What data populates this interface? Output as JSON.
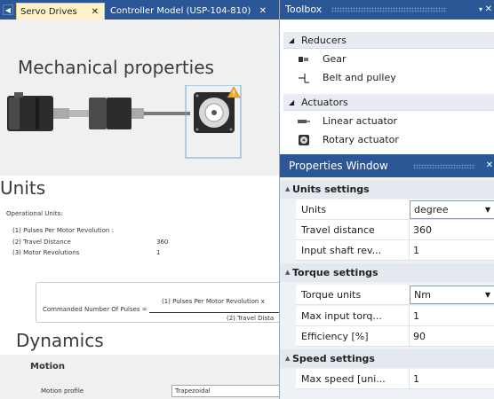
{
  "tabs": [
    {
      "label": "Servo Drives",
      "close": "✕",
      "active": true
    },
    {
      "label": "Controller Model (USP-104-810)",
      "close": "✕",
      "active": false
    }
  ],
  "document": {
    "mechanical_title": "Mechanical properties",
    "units_title": "Units",
    "operational_units_label": "Operational Units:",
    "unit_rows": [
      {
        "label": "(1) Pulses Per Motor Revolution :",
        "value": ""
      },
      {
        "label": "(2) Travel Distance",
        "value": "360"
      },
      {
        "label": "(3) Motor Revolutions",
        "value": "1"
      }
    ],
    "formula_left": "Commanded Number Of Pulses =",
    "formula_numerator": "(1) Pulses Per Motor Revolution x",
    "formula_denominator": "(2) Travel Dista",
    "dynamics_title": "Dynamics",
    "motion_label": "Motion",
    "motion_profile_label": "Motion profile",
    "motion_profile_value": "Trapezoidal"
  },
  "toolbox": {
    "title": "Toolbox",
    "pin_glyph": "▾",
    "close_glyph": "✕",
    "groups": [
      {
        "name": "Reducers",
        "items": [
          {
            "label": "Gear",
            "icon": "gear-tool-icon"
          },
          {
            "label": "Belt and pulley",
            "icon": "belt-pulley-icon"
          }
        ]
      },
      {
        "name": "Actuators",
        "items": [
          {
            "label": "Linear actuator",
            "icon": "linear-actuator-icon"
          },
          {
            "label": "Rotary actuator",
            "icon": "rotary-actuator-icon"
          }
        ]
      }
    ]
  },
  "properties": {
    "title": "Properties Window",
    "close_glyph": "✕",
    "categories": [
      {
        "name": "Units settings",
        "rows": [
          {
            "name": "Units",
            "value": "degree",
            "dropdown": true
          },
          {
            "name": "Travel distance",
            "value": "360"
          },
          {
            "name": "Input shaft rev...",
            "value": "1"
          }
        ]
      },
      {
        "name": "Torque settings",
        "rows": [
          {
            "name": "Torque units",
            "value": "Nm",
            "dropdown": true
          },
          {
            "name": "Max input torq...",
            "value": "1"
          },
          {
            "name": "Efficiency [%]",
            "value": "90"
          }
        ]
      },
      {
        "name": "Speed settings",
        "rows": [
          {
            "name": "Max speed [uni...",
            "value": "1"
          }
        ]
      }
    ]
  },
  "colors": {
    "header_blue": "#2b5797",
    "active_tab": "#fef3c8",
    "warning": "#f5a623"
  }
}
